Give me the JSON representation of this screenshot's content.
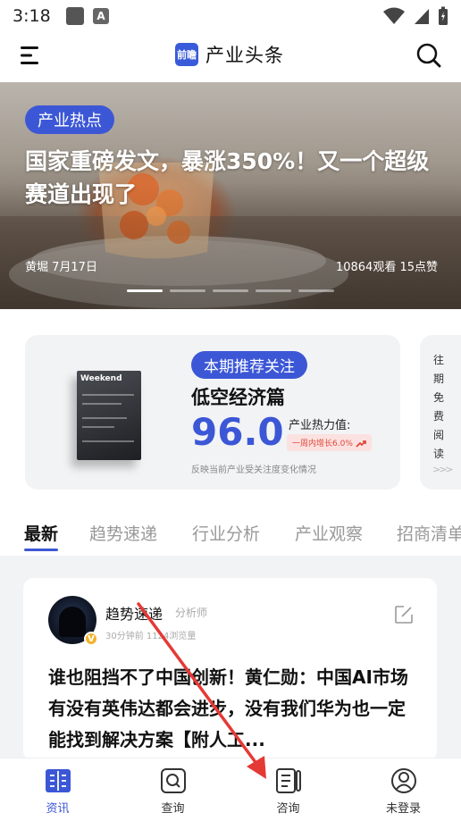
{
  "status_bar": {
    "time": "3:18",
    "a_label": "A"
  },
  "header": {
    "brand_logo_text": "前瞻",
    "title": "产业头条"
  },
  "hero": {
    "tag": "产业热点",
    "title": "国家重磅发文，暴涨350%！又一个超级赛道出现了",
    "author_date": "黄堀 7月17日",
    "stats": "10864观看 15点赞",
    "active_dot": 1,
    "dot_count": 5
  },
  "recommend": {
    "tag": "本期推荐关注",
    "title": "低空经济篇",
    "score": "96.0",
    "heat_label": "产业热力值:",
    "heat_badge": "一周内增长6.0%",
    "desc": "反映当前产业受关注度变化情况",
    "magazine_label": "Weekend"
  },
  "past_reading": {
    "label": "往期免费阅读",
    "arrow": ">>>"
  },
  "tabs": [
    "最新",
    "趋势速递",
    "行业分析",
    "产业观察",
    "招商清单"
  ],
  "article": {
    "author": "趋势速递",
    "role": "分析师",
    "meta": "30分钟前 1124浏览量",
    "title": "谁也阻挡不了中国创新！黄仁勋：中国AI市场有没有英伟达都会进步，没有我们华为也一定能找到解决方案【附人工..."
  },
  "bottom_nav": [
    {
      "label": "资讯",
      "icon": "news-icon",
      "active": true
    },
    {
      "label": "查询",
      "icon": "query-icon",
      "active": false
    },
    {
      "label": "咨询",
      "icon": "consult-icon",
      "active": false
    },
    {
      "label": "未登录",
      "icon": "user-icon",
      "active": false
    }
  ],
  "colors": {
    "accent": "#3c57d6",
    "badge_red": "#e0473c",
    "annotation": "#e53935"
  }
}
